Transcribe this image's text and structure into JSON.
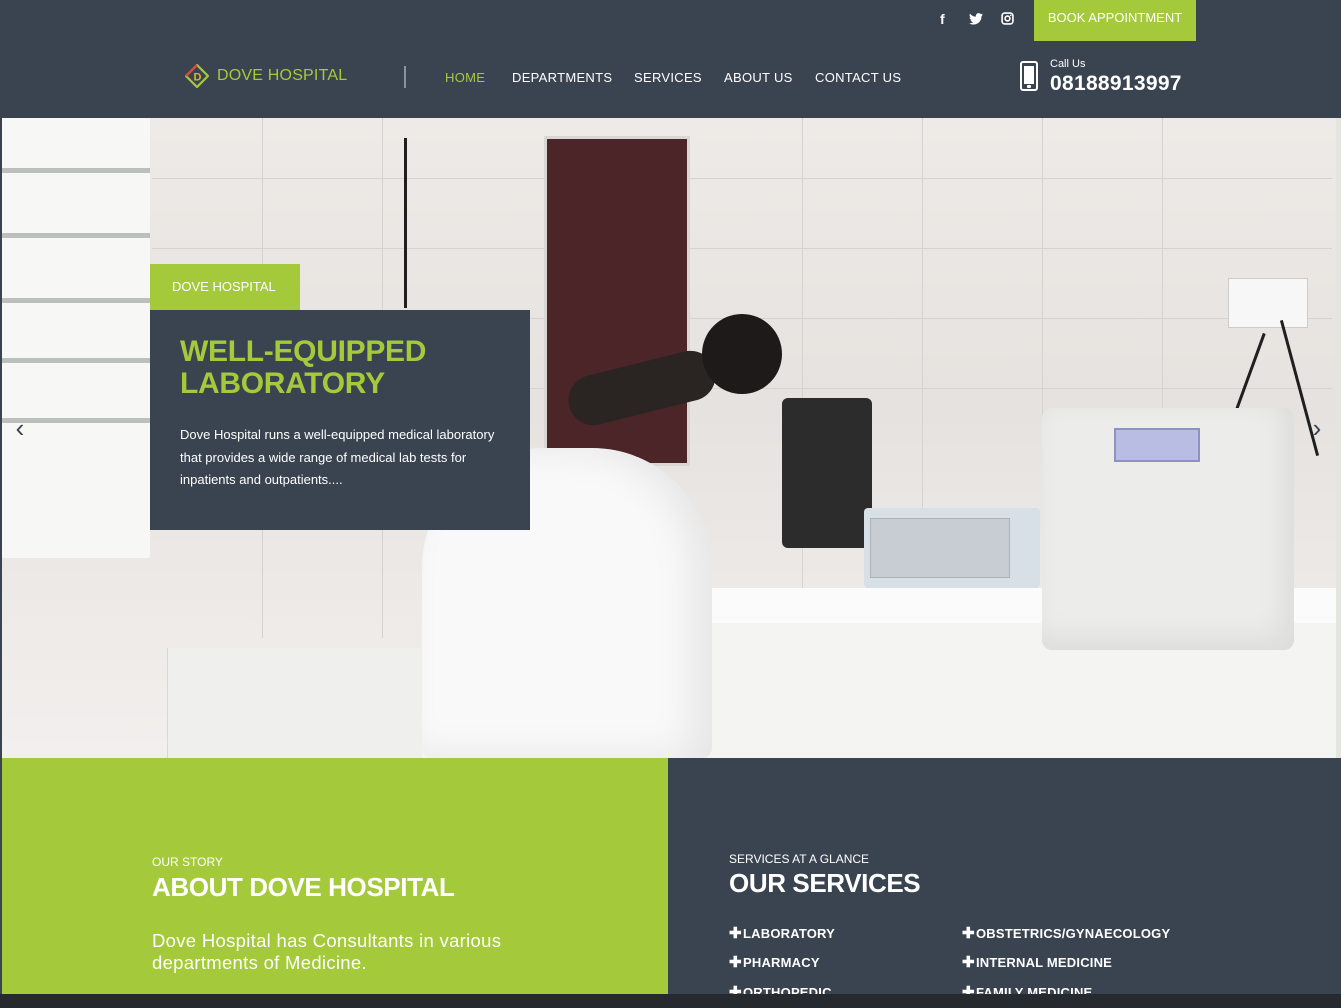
{
  "header": {
    "social": [
      {
        "name": "facebook",
        "glyph": "f"
      },
      {
        "name": "twitter",
        "glyph": "🐦"
      },
      {
        "name": "instagram",
        "glyph": "◘"
      }
    ],
    "book_button": "BOOK APPOINTMENT",
    "logo_text": "DOVE HOSPITAL",
    "nav": [
      {
        "label": "HOME",
        "active": true
      },
      {
        "label": "DEPARTMENTS",
        "active": false
      },
      {
        "label": "SERVICES",
        "active": false
      },
      {
        "label": "ABOUT US",
        "active": false
      },
      {
        "label": "CONTACT US",
        "active": false
      }
    ],
    "call_label": "Call Us",
    "call_number": "08188913997"
  },
  "hero": {
    "tag": "DOVE HOSPITAL",
    "title": "WELL-EQUIPPED LABORATORY",
    "text": "Dove Hospital runs a well-equipped medical laboratory that provides a wide range of medical lab tests for inpatients and outpatients....",
    "prev_glyph": "‹",
    "next_glyph": "›"
  },
  "about": {
    "eyebrow": "OUR STORY",
    "title": "ABOUT DOVE HOSPITAL",
    "text": "Dove Hospital has Consultants in various departments of Medicine."
  },
  "services": {
    "eyebrow": "SERVICES AT A GLANCE",
    "title": "OUR SERVICES",
    "items_left": [
      "LABORATORY",
      "PHARMACY",
      "ORTHOPEDIC"
    ],
    "items_right": [
      "OBSTETRICS/GYNAECOLOGY",
      "INTERNAL MEDICINE",
      "FAMILY MEDICINE"
    ]
  },
  "colors": {
    "brand_green": "#a4ca3b",
    "brand_dark": "#3a4451"
  }
}
